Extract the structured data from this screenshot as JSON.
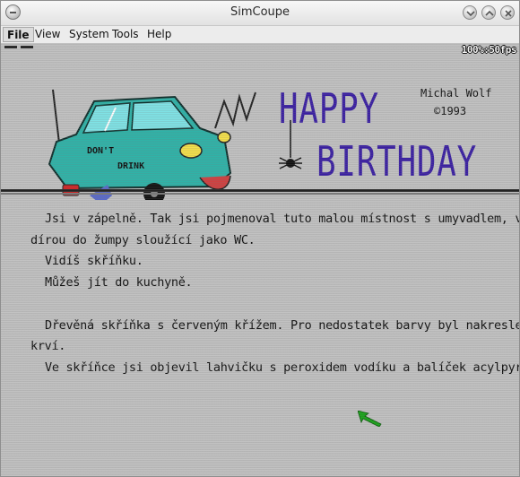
{
  "window": {
    "title": "SimCoupe"
  },
  "menubar": {
    "items": [
      "File",
      "View",
      "System",
      "Tools",
      "Help"
    ],
    "active": "File"
  },
  "screen": {
    "fps": "100%:50fps",
    "banner": {
      "happy": "HAPPY",
      "birthday": "BIRTHDAY",
      "author": "Michal Wolf",
      "year": "©1993",
      "car_sign_line1": "DON'T",
      "car_sign_line2": "DRINK"
    },
    "paragraphs": [
      "Jsi v zápelně. Tak jsi pojmenoval tuto malou místnost s umyvadlem, vanou a",
      "dírou do žumpy sloužící jako WC.",
      "Vidíš skříňku.",
      "Můžeš jít do kuchyně.",
      "",
      "Dřevěná skříňka s červeným křížem. Pro nedostatek barvy byl nakreslen",
      "krví.",
      "Ve skříňce jsi objevil lahvičku s peroxidem vodíku a balíček acylpyrinu."
    ],
    "colors": {
      "banner_text": "#3a1fa3",
      "car_body": "#2fb3a8",
      "cursor": "#1aa31a",
      "background": "#c2c2c2"
    }
  }
}
